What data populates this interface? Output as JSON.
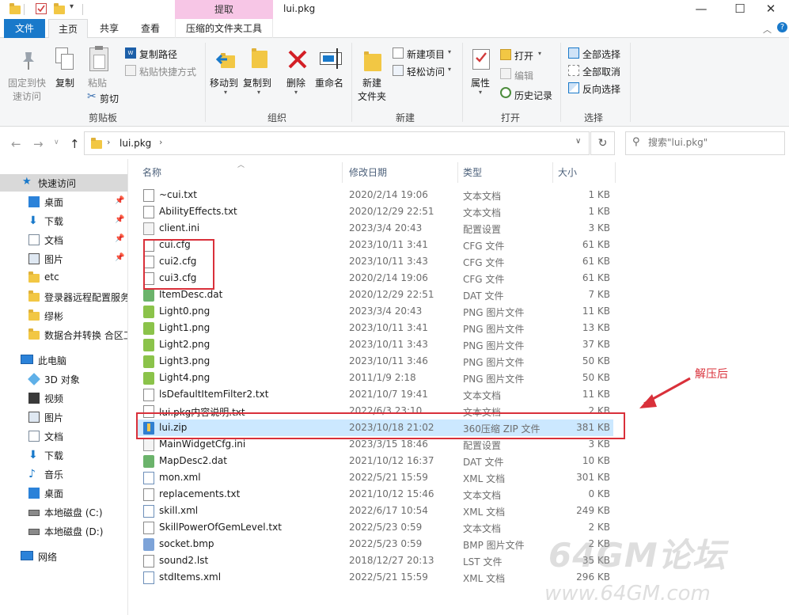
{
  "window": {
    "title": "lui.pkg",
    "context_tab": "提取",
    "minimize_glyph": "—",
    "maximize_glyph": "☐",
    "close_glyph": "✕"
  },
  "ribbon_tabs": {
    "file": "文件",
    "home": "主页",
    "share": "共享",
    "view": "查看",
    "compress_tools": "压缩的文件夹工具"
  },
  "ribbon": {
    "clipboard": {
      "pin_quick_access": "固定到快",
      "pin_quick_access_2": "速访问",
      "copy": "复制",
      "paste": "粘贴",
      "copy_path": "复制路径",
      "paste_shortcut": "粘贴快捷方式",
      "cut": "剪切",
      "group": "剪贴板"
    },
    "organize": {
      "move_to": "移动到",
      "copy_to": "复制到",
      "delete": "删除",
      "rename": "重命名",
      "group": "组织"
    },
    "new": {
      "new_folder": "新建",
      "new_folder_2": "文件夹",
      "new_item": "新建项目",
      "easy_access": "轻松访问",
      "group": "新建"
    },
    "open": {
      "properties": "属性",
      "open": "打开",
      "edit": "编辑",
      "history": "历史记录",
      "group": "打开"
    },
    "select": {
      "select_all": "全部选择",
      "select_none": "全部取消",
      "invert": "反向选择",
      "group": "选择"
    }
  },
  "address": {
    "path_item": "lui.pkg",
    "search_placeholder": "搜索\"lui.pkg\""
  },
  "nav_pane": {
    "quick_access": "快速访问",
    "items": [
      {
        "label": "桌面",
        "pinned": true
      },
      {
        "label": "下载",
        "pinned": true
      },
      {
        "label": "文档",
        "pinned": true
      },
      {
        "label": "图片",
        "pinned": true
      },
      {
        "label": "etc",
        "pinned": false
      },
      {
        "label": "登录器远程配置服务",
        "pinned": false
      },
      {
        "label": "缪彬",
        "pinned": false
      },
      {
        "label": "数据合并转换 合区工",
        "pinned": false
      }
    ],
    "this_pc": "此电脑",
    "pc_items": [
      "3D 对象",
      "视频",
      "图片",
      "文档",
      "下载",
      "音乐",
      "桌面",
      "本地磁盘 (C:)",
      "本地磁盘 (D:)"
    ],
    "network": "网络"
  },
  "columns": {
    "name": "名称",
    "date": "修改日期",
    "type": "类型",
    "size": "大小"
  },
  "files": [
    {
      "name": "~cui.txt",
      "date": "2020/2/14 19:06",
      "type": "文本文档",
      "size": "1 KB",
      "icon": "doc"
    },
    {
      "name": "AbilityEffects.txt",
      "date": "2020/12/29 22:51",
      "type": "文本文档",
      "size": "1 KB",
      "icon": "doc"
    },
    {
      "name": "client.ini",
      "date": "2023/3/4 20:43",
      "type": "配置设置",
      "size": "3 KB",
      "icon": "cfg"
    },
    {
      "name": "cui.cfg",
      "date": "2023/10/11 3:41",
      "type": "CFG 文件",
      "size": "61 KB",
      "icon": "doc"
    },
    {
      "name": "cui2.cfg",
      "date": "2023/10/11 3:43",
      "type": "CFG 文件",
      "size": "61 KB",
      "icon": "doc"
    },
    {
      "name": "cui3.cfg",
      "date": "2020/2/14 19:06",
      "type": "CFG 文件",
      "size": "61 KB",
      "icon": "doc"
    },
    {
      "name": "ItemDesc.dat",
      "date": "2020/12/29 22:51",
      "type": "DAT 文件",
      "size": "7 KB",
      "icon": "dat"
    },
    {
      "name": "Light0.png",
      "date": "2023/3/4 20:43",
      "type": "PNG 图片文件",
      "size": "11 KB",
      "icon": "img"
    },
    {
      "name": "Light1.png",
      "date": "2023/10/11 3:41",
      "type": "PNG 图片文件",
      "size": "13 KB",
      "icon": "img"
    },
    {
      "name": "Light2.png",
      "date": "2023/10/11 3:43",
      "type": "PNG 图片文件",
      "size": "37 KB",
      "icon": "img"
    },
    {
      "name": "Light3.png",
      "date": "2023/10/11 3:46",
      "type": "PNG 图片文件",
      "size": "50 KB",
      "icon": "img"
    },
    {
      "name": "Light4.png",
      "date": "2011/1/9 2:18",
      "type": "PNG 图片文件",
      "size": "50 KB",
      "icon": "img"
    },
    {
      "name": "lsDefaultItemFilter2.txt",
      "date": "2021/10/7 19:41",
      "type": "文本文档",
      "size": "11 KB",
      "icon": "doc"
    },
    {
      "name": "lui.pkg内容说明.txt",
      "date": "2022/6/3 23:10",
      "type": "文本文档",
      "size": "2 KB",
      "icon": "doc"
    },
    {
      "name": "lui.zip",
      "date": "2023/10/18 21:02",
      "type": "360压缩 ZIP 文件",
      "size": "381 KB",
      "icon": "zip",
      "selected": true
    },
    {
      "name": "MainWidgetCfg.ini",
      "date": "2023/3/15 18:46",
      "type": "配置设置",
      "size": "3 KB",
      "icon": "cfg"
    },
    {
      "name": "MapDesc2.dat",
      "date": "2021/10/12 16:37",
      "type": "DAT 文件",
      "size": "10 KB",
      "icon": "dat"
    },
    {
      "name": "mon.xml",
      "date": "2022/5/21 15:59",
      "type": "XML 文档",
      "size": "301 KB",
      "icon": "xml"
    },
    {
      "name": "replacements.txt",
      "date": "2021/10/12 15:46",
      "type": "文本文档",
      "size": "0 KB",
      "icon": "doc"
    },
    {
      "name": "skill.xml",
      "date": "2022/6/17 10:54",
      "type": "XML 文档",
      "size": "249 KB",
      "icon": "xml"
    },
    {
      "name": "SkillPowerOfGemLevel.txt",
      "date": "2022/5/23 0:59",
      "type": "文本文档",
      "size": "2 KB",
      "icon": "doc"
    },
    {
      "name": "socket.bmp",
      "date": "2022/5/23 0:59",
      "type": "BMP 图片文件",
      "size": "2 KB",
      "icon": "bmp"
    },
    {
      "name": "sound2.lst",
      "date": "2018/12/27 20:13",
      "type": "LST 文件",
      "size": "35 KB",
      "icon": "doc"
    },
    {
      "name": "stdItems.xml",
      "date": "2022/5/21 15:59",
      "type": "XML 文档",
      "size": "296 KB",
      "icon": "xml"
    }
  ],
  "annotation": {
    "text": "解压后"
  },
  "watermark": {
    "main": "64GM论坛",
    "url": "www.64GM.com"
  },
  "colors": {
    "accent": "#1979ca",
    "selection": "#cce8ff",
    "annotation_red": "#d9303a",
    "context_tab": "#f7c6e6"
  }
}
